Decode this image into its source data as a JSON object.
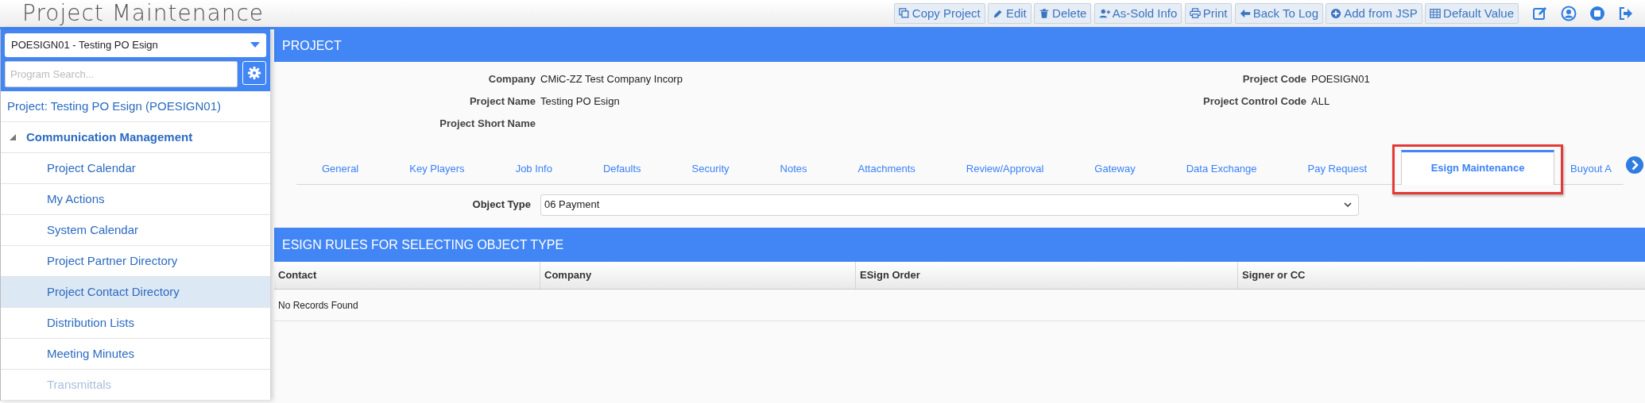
{
  "app_title": "Project Maintenance",
  "toolbar": [
    {
      "label": "Copy Project",
      "kind": "copy"
    },
    {
      "label": "Edit",
      "kind": "edit"
    },
    {
      "label": "Delete",
      "kind": "delete"
    },
    {
      "label": "As-Sold Info",
      "kind": "user"
    },
    {
      "label": "Print",
      "kind": "print"
    },
    {
      "label": "Back To Log",
      "kind": "back"
    },
    {
      "label": "Add from JSP",
      "kind": "add"
    },
    {
      "label": "Default Value",
      "kind": "table"
    }
  ],
  "sidebar": {
    "project_select": "POESIGN01 - Testing PO Esign",
    "search_placeholder": "Program Search...",
    "project_link": "Project: Testing PO Esign (POESIGN01)",
    "tree": [
      {
        "label": "Communication Management",
        "expanded": true,
        "children": [
          {
            "label": "Project Calendar",
            "selected": false,
            "disabled": false
          },
          {
            "label": "My Actions",
            "selected": false,
            "disabled": false
          },
          {
            "label": "System Calendar",
            "selected": false,
            "disabled": false
          },
          {
            "label": "Project Partner Directory",
            "selected": false,
            "disabled": false
          },
          {
            "label": "Project Contact Directory",
            "selected": true,
            "disabled": false
          },
          {
            "label": "Distribution Lists",
            "selected": false,
            "disabled": false
          },
          {
            "label": "Meeting Minutes",
            "selected": false,
            "disabled": false
          },
          {
            "label": "Transmittals",
            "selected": false,
            "disabled": true
          }
        ]
      }
    ]
  },
  "project": {
    "title": "PROJECT",
    "fields_left": [
      {
        "label": "Company",
        "value": "CMiC-ZZ Test Company Incorp"
      },
      {
        "label": "Project Name",
        "value": "Testing PO Esign"
      },
      {
        "label": "Project Short Name"
      }
    ],
    "fields_right": [
      {
        "label": "Project Code",
        "value": "POESIGN01"
      },
      {
        "label": "Project Control Code",
        "value": "ALL"
      }
    ]
  },
  "tabs": [
    {
      "label": "General",
      "selected": false,
      "highlighted": false
    },
    {
      "label": "Key Players",
      "selected": false,
      "highlighted": false
    },
    {
      "label": "Job Info",
      "selected": false,
      "highlighted": false
    },
    {
      "label": "Defaults",
      "selected": false,
      "highlighted": false
    },
    {
      "label": "Security",
      "selected": false,
      "highlighted": false
    },
    {
      "label": "Notes",
      "selected": false,
      "highlighted": false
    },
    {
      "label": "Attachments",
      "selected": false,
      "highlighted": false
    },
    {
      "label": "Review/Approval",
      "selected": false,
      "highlighted": false
    },
    {
      "label": "Gateway",
      "selected": false,
      "highlighted": false
    },
    {
      "label": "Data Exchange",
      "selected": false,
      "highlighted": false
    },
    {
      "label": "Pay Request",
      "selected": false,
      "highlighted": false
    },
    {
      "label": "Esign Maintenance",
      "selected": true,
      "highlighted": true
    },
    {
      "label": "Buyout A",
      "selected": false,
      "highlighted": false
    }
  ],
  "object_type": {
    "label": "Object Type",
    "value": "06 Payment"
  },
  "esign": {
    "title": "ESIGN RULES FOR SELECTING OBJECT TYPE",
    "columns": [
      "Contact",
      "Company",
      "ESign Order",
      "Signer or CC"
    ],
    "empty_message": "No Records Found"
  }
}
